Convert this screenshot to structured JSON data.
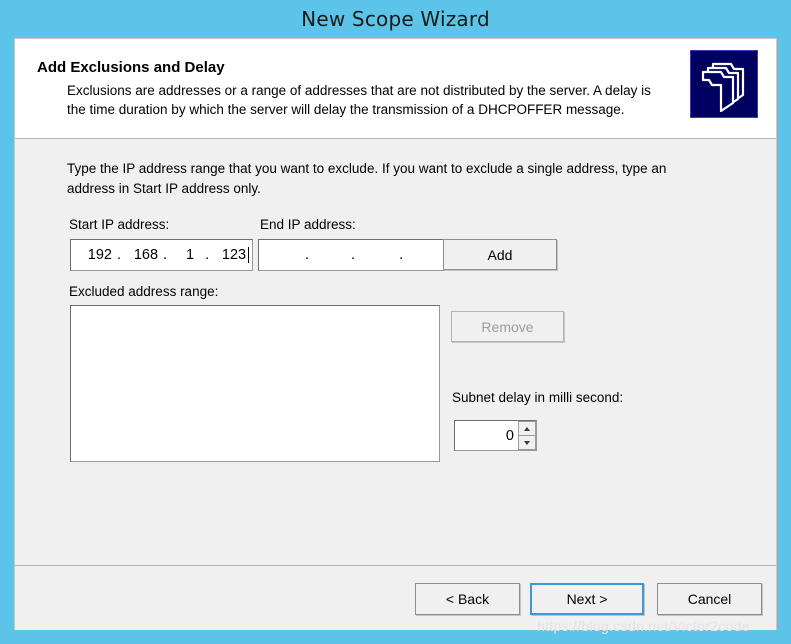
{
  "window": {
    "title": "New Scope Wizard"
  },
  "header": {
    "title": "Add Exclusions and Delay",
    "description": "Exclusions are addresses or a range of addresses that are not distributed by the server. A delay is the time duration by which the server will delay the transmission of a DHCPOFFER message.",
    "icon": "folder-stack-icon"
  },
  "main": {
    "intro": "Type the IP address range that you want to exclude. If you want to exclude a single address, type an address in Start IP address only.",
    "start_ip": {
      "label": "Start IP address:",
      "octets": [
        "192",
        "168",
        "1",
        "123"
      ],
      "placeholder": ""
    },
    "end_ip": {
      "label": "End IP address:",
      "octets": [
        "",
        "",
        "",
        ""
      ],
      "placeholder": ""
    },
    "add_button": "Add",
    "excluded_range": {
      "label": "Excluded address range:",
      "items": []
    },
    "remove_button": "Remove",
    "remove_enabled": false,
    "subnet_delay": {
      "label": "Subnet delay in milli second:",
      "value": "0"
    }
  },
  "footer": {
    "back_button": "< Back",
    "next_button": "Next >",
    "cancel_button": "Cancel"
  },
  "watermark": "https://blog.csdn.net/Victor2code",
  "colors": {
    "title_bar": "#5bc4e8",
    "dialog_bg": "#f0f0f0",
    "header_bg": "#ffffff",
    "icon_bg": "#000060",
    "default_button_border": "#3c99d4"
  }
}
